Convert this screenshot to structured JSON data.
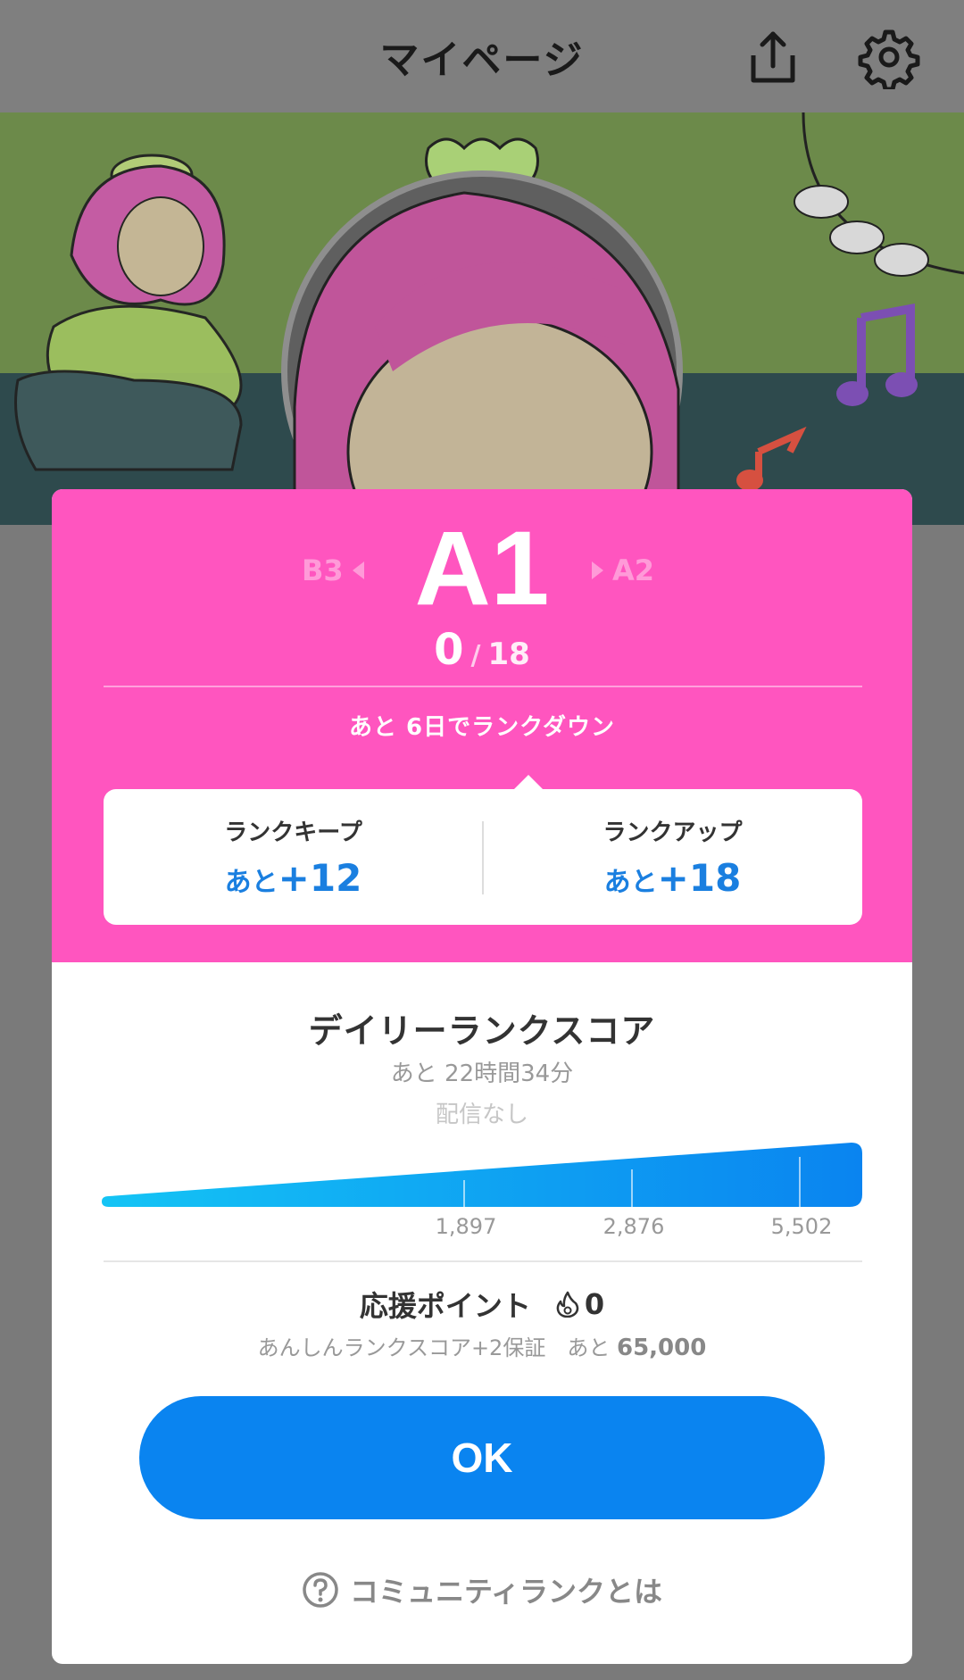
{
  "header": {
    "title": "マイページ",
    "share_icon": "share-icon",
    "settings_icon": "gear-icon"
  },
  "colors": {
    "header_bg": "#7f7f7f",
    "rank_pink": "#ff55bf",
    "accent_blue": "#0a84f0",
    "value_blue": "#1a7fe0"
  },
  "rank": {
    "prev": "B3",
    "current": "A1",
    "next": "A2",
    "score": "0",
    "separator": "/",
    "max": "18",
    "status": "あと 6日でランクダウン"
  },
  "stats": {
    "keep_label": "ランクキープ",
    "keep_prefix": "あと",
    "keep_value": "+12",
    "up_label": "ランクアップ",
    "up_prefix": "あと",
    "up_value": "+18"
  },
  "daily": {
    "title": "デイリーランクスコア",
    "remaining": "あと 22時間34分",
    "stream_status": "配信なし",
    "progress": 0,
    "thresholds": [
      "1,897",
      "2,876",
      "5,502"
    ]
  },
  "support": {
    "label": "応援ポイント",
    "icon": "flame-icon",
    "value": "0",
    "note_prefix": "あんしんランクスコア+2保証　あと",
    "note_value": "65,000"
  },
  "ok_button": {
    "label": "OK"
  },
  "help": {
    "icon": "question-circle-icon",
    "label": "コミュニティランクとは"
  }
}
